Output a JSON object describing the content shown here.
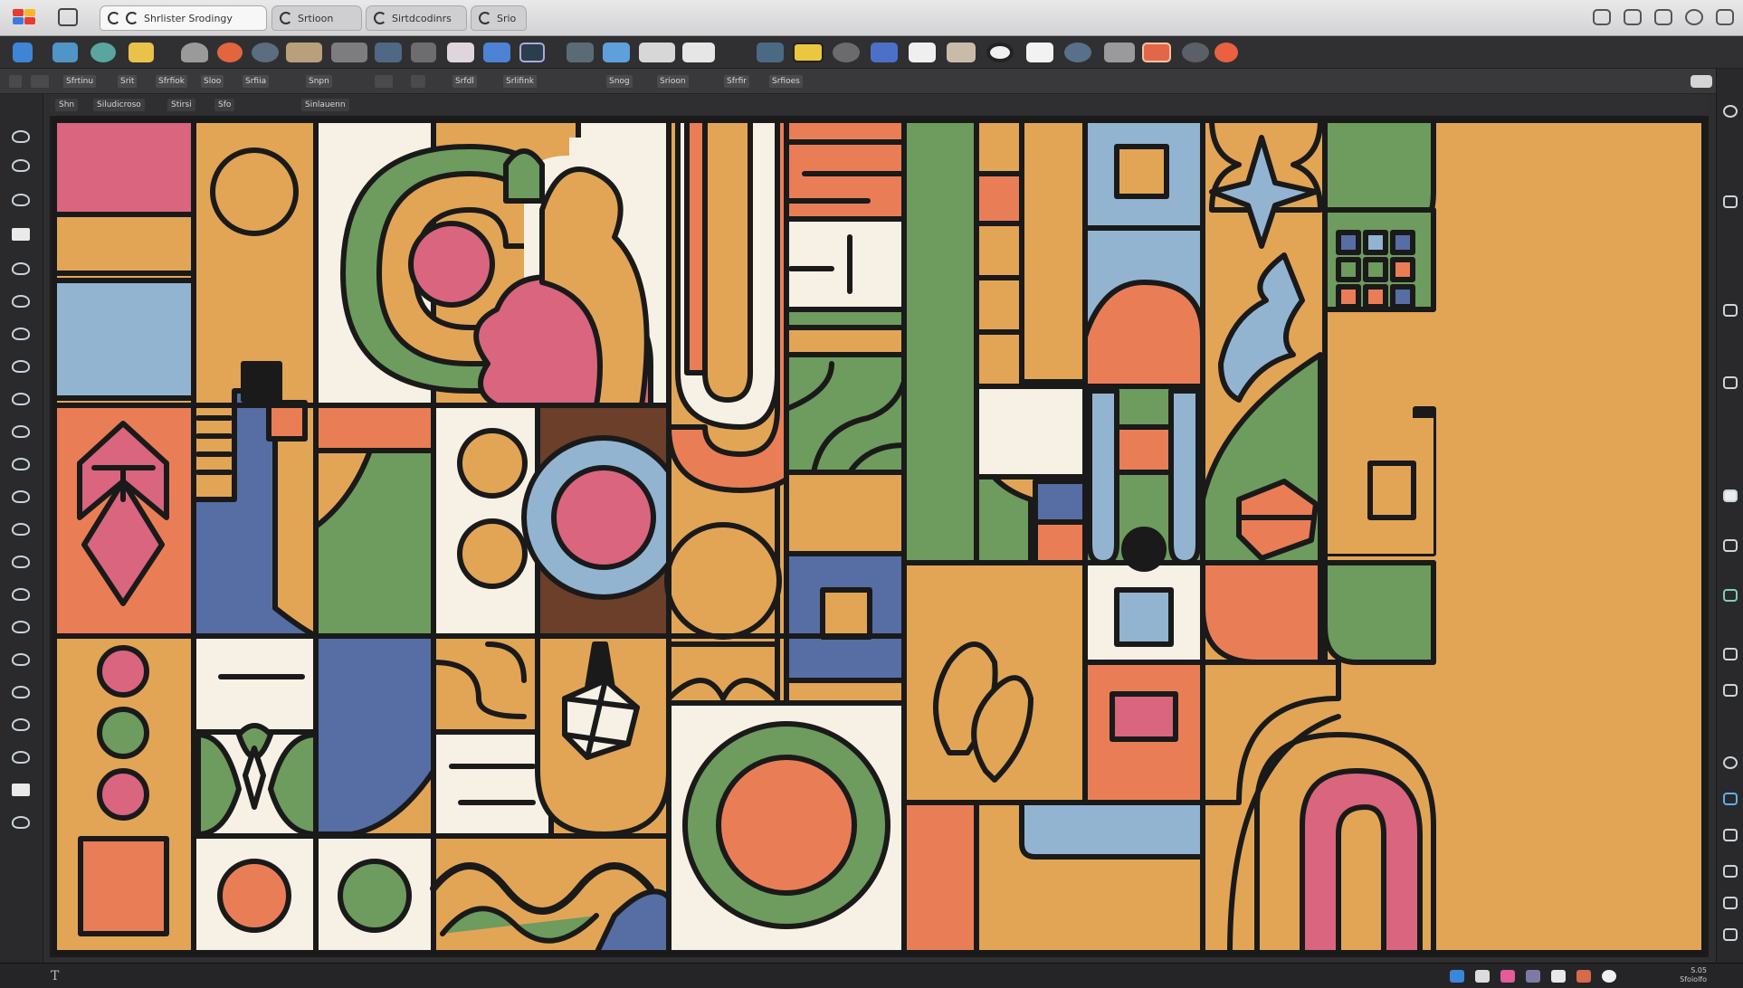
{
  "tabs": [
    {
      "label": "Shrlister Srodingy",
      "active": true
    },
    {
      "label": "Srtioon",
      "active": false
    },
    {
      "label": "Sirtdcodinrs",
      "active": false
    },
    {
      "label": "Srio",
      "active": false
    }
  ],
  "toolbar2_labels": [
    "Sfrtinu",
    "Srit",
    "Sfrfiok",
    "Sloo",
    "Srfiia",
    "Snpn",
    "Srfdl",
    "Srlifink",
    "Snog",
    "Srioon",
    "Sfrfir",
    "Srfioes"
  ],
  "options_bar": [
    "Shn",
    "Siludicroso",
    "Stirsi",
    "Sfo",
    "Sinlauenn"
  ],
  "status": {
    "tool_letter": "T",
    "zoom_line1": "S.05",
    "zoom_line2": "Sfoiolfo"
  },
  "palette": {
    "cream": "#f6f1e4",
    "mustard": "#e2a556",
    "sage": "#6e9b5e",
    "coral": "#e97e56",
    "pink": "#d9657f",
    "sky": "#93b4d1",
    "navy": "#566ea4",
    "brown": "#6b3f2a",
    "stroke": "#1a1a1a"
  },
  "icons": [
    "app-logo-icon",
    "layout-icon",
    "tab-icon",
    "brush-icon",
    "square-icon",
    "text-icon"
  ]
}
